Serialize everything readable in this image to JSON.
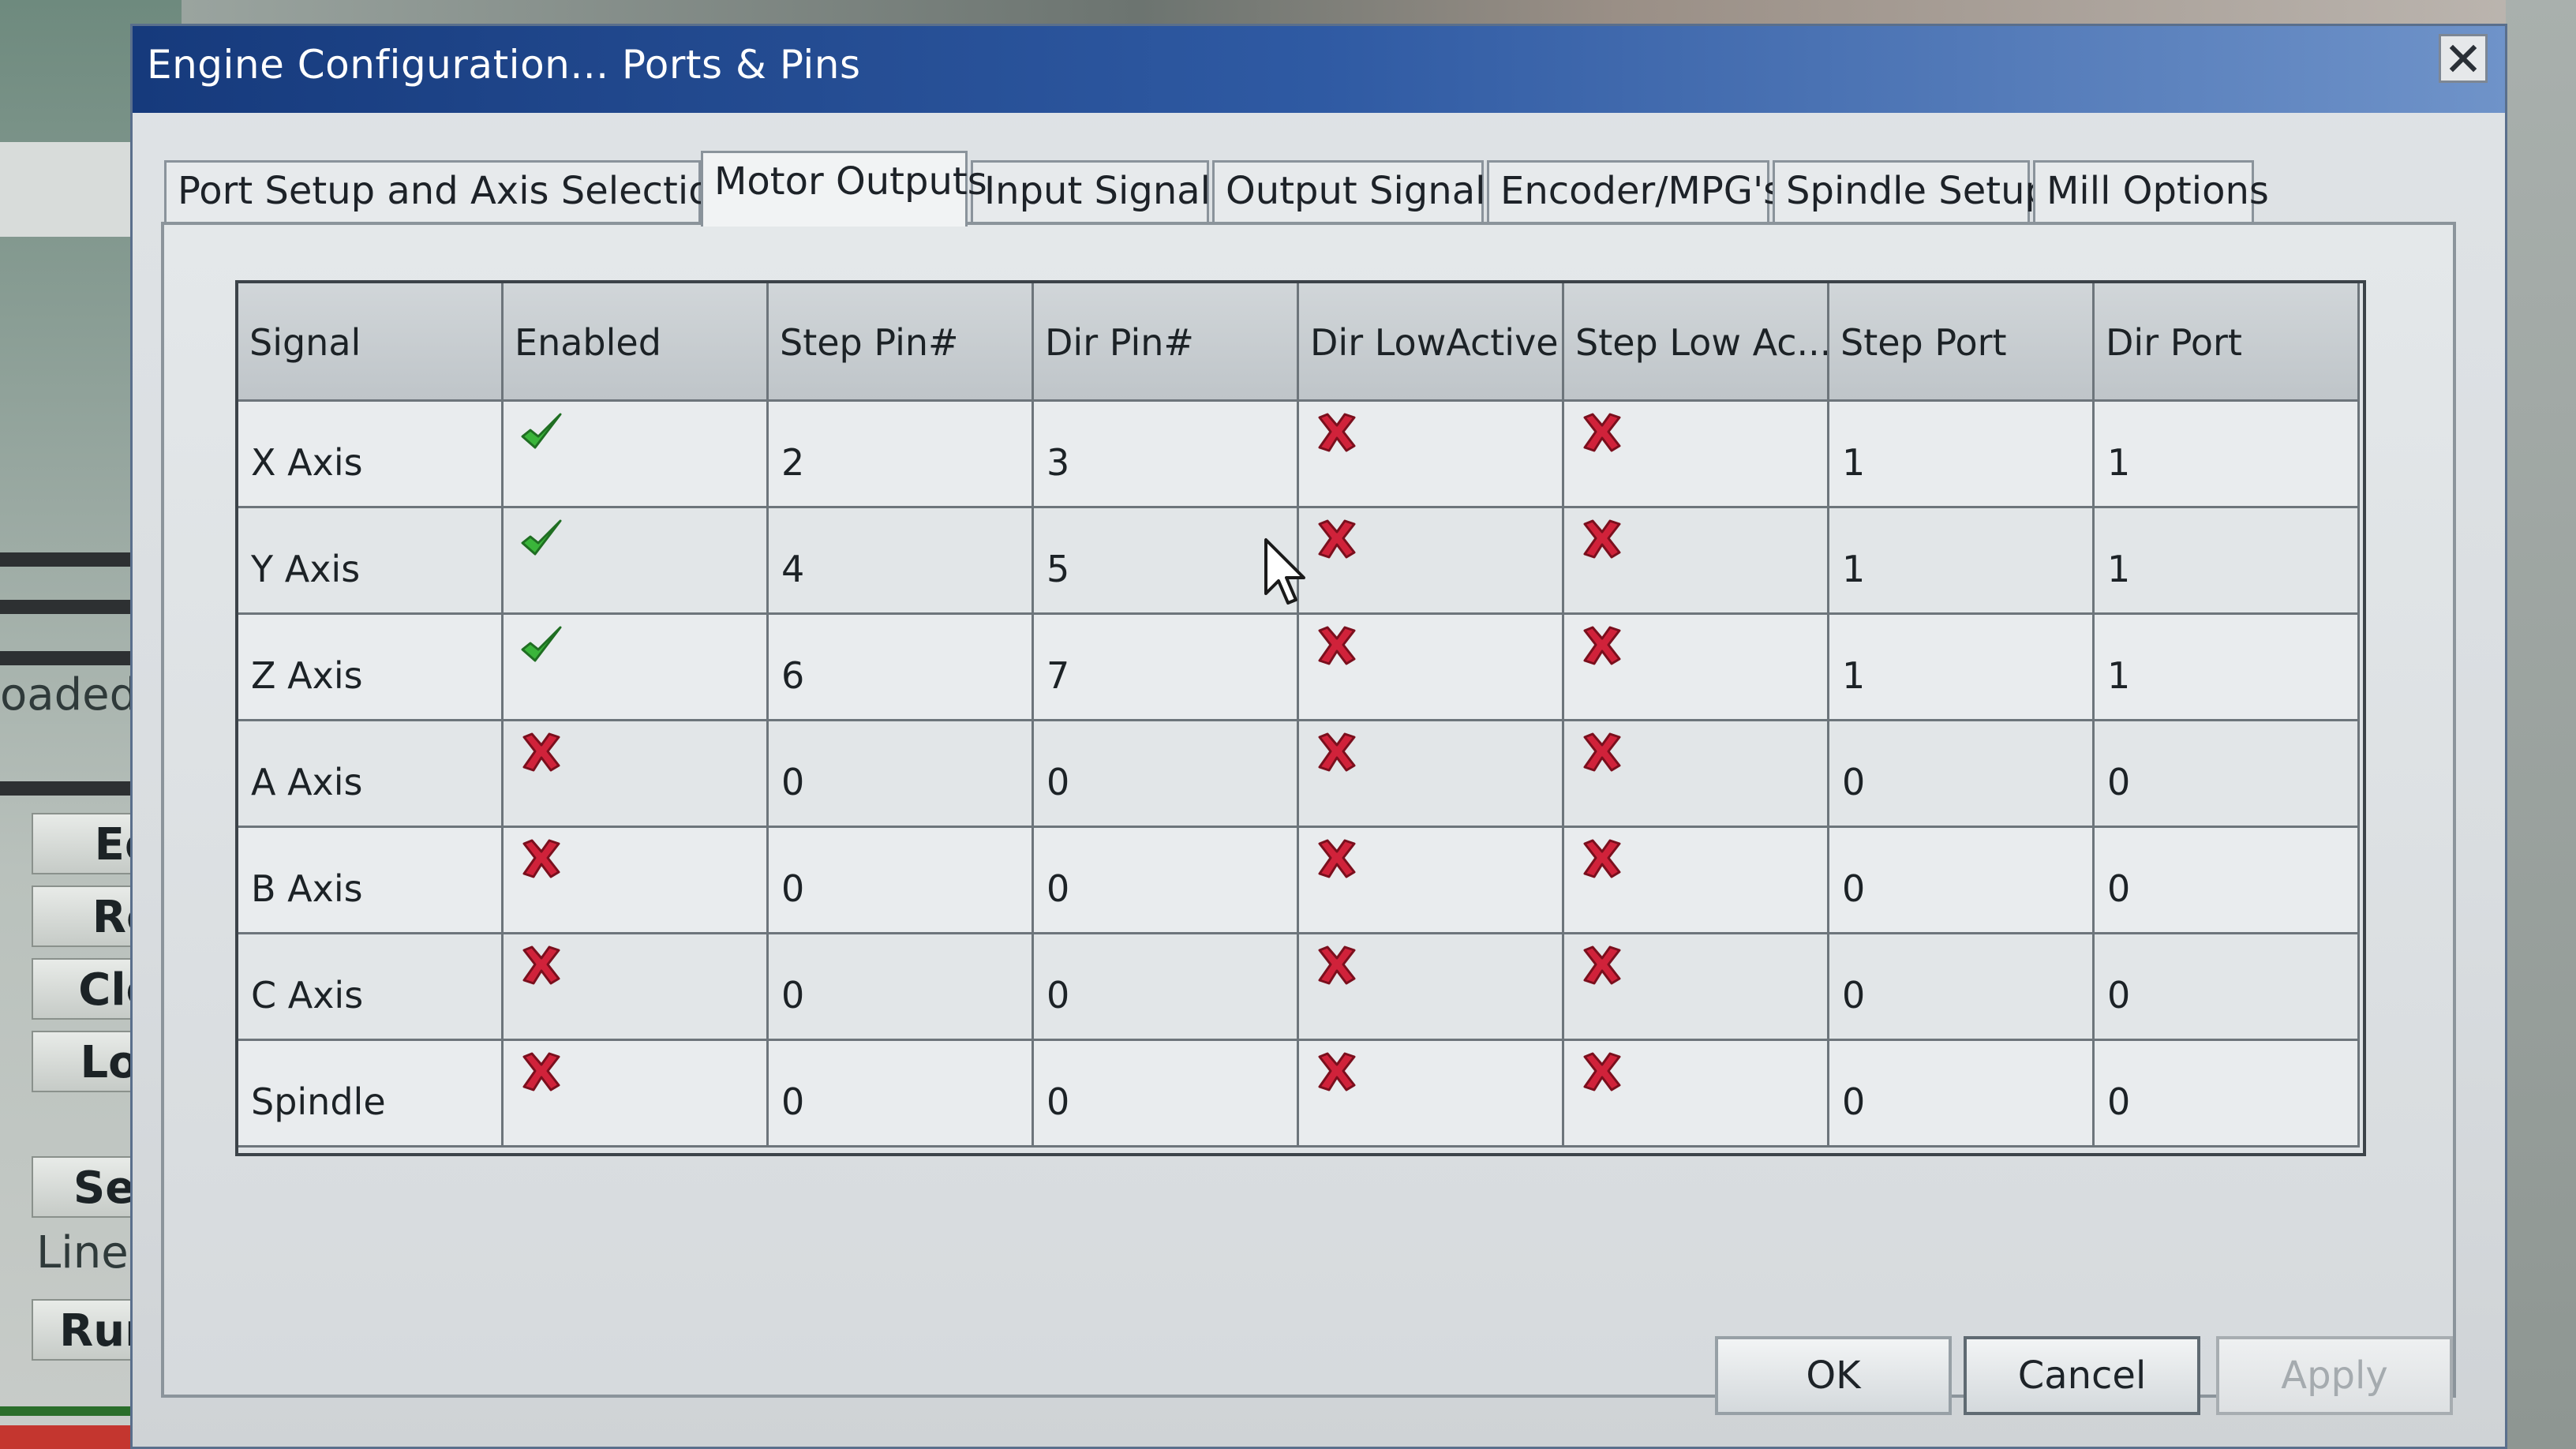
{
  "background_app": {
    "loaded_text": "oaded.",
    "buttons": [
      "Ed",
      "Re",
      "Clo",
      "Lo:",
      "Set",
      "Run"
    ],
    "line_label": "Line:"
  },
  "dialog": {
    "title": "Engine Configuration... Ports & Pins",
    "close_icon": "close-icon",
    "tabs": [
      {
        "label": "Port Setup and Axis Selection"
      },
      {
        "label": "Motor Outputs"
      },
      {
        "label": "Input Signals"
      },
      {
        "label": "Output Signals"
      },
      {
        "label": "Encoder/MPG's"
      },
      {
        "label": "Spindle Setup"
      },
      {
        "label": "Mill Options"
      }
    ],
    "active_tab": "Motor Outputs",
    "grid": {
      "columns": [
        "Signal",
        "Enabled",
        "Step Pin#",
        "Dir Pin#",
        "Dir LowActive",
        "Step Low Ac...",
        "Step Port",
        "Dir Port"
      ],
      "rows": [
        {
          "signal": "X Axis",
          "enabled": true,
          "step_pin": "2",
          "dir_pin": "3",
          "dir_low_active": false,
          "step_low_active": false,
          "step_port": "1",
          "dir_port": "1"
        },
        {
          "signal": "Y Axis",
          "enabled": true,
          "step_pin": "4",
          "dir_pin": "5",
          "dir_low_active": false,
          "step_low_active": false,
          "step_port": "1",
          "dir_port": "1"
        },
        {
          "signal": "Z Axis",
          "enabled": true,
          "step_pin": "6",
          "dir_pin": "7",
          "dir_low_active": false,
          "step_low_active": false,
          "step_port": "1",
          "dir_port": "1"
        },
        {
          "signal": "A Axis",
          "enabled": false,
          "step_pin": "0",
          "dir_pin": "0",
          "dir_low_active": false,
          "step_low_active": false,
          "step_port": "0",
          "dir_port": "0"
        },
        {
          "signal": "B Axis",
          "enabled": false,
          "step_pin": "0",
          "dir_pin": "0",
          "dir_low_active": false,
          "step_low_active": false,
          "step_port": "0",
          "dir_port": "0"
        },
        {
          "signal": "C Axis",
          "enabled": false,
          "step_pin": "0",
          "dir_pin": "0",
          "dir_low_active": false,
          "step_low_active": false,
          "step_port": "0",
          "dir_port": "0"
        },
        {
          "signal": "Spindle",
          "enabled": false,
          "step_pin": "0",
          "dir_pin": "0",
          "dir_low_active": false,
          "step_low_active": false,
          "step_port": "0",
          "dir_port": "0"
        }
      ]
    },
    "buttons": {
      "ok": "OK",
      "cancel": "Cancel",
      "apply": "Apply"
    },
    "colors": {
      "check_green": "#3ab53a",
      "x_red": "#d0223a",
      "title_blue": "#1f4a93"
    }
  }
}
